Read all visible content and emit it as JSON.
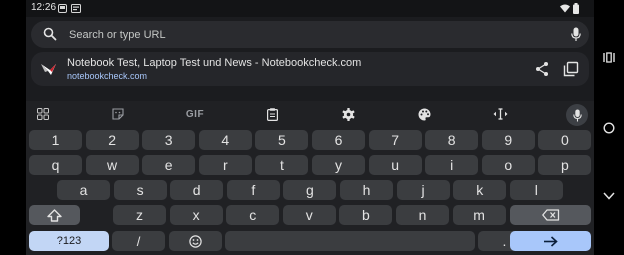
{
  "status_bar": {
    "time": "12:26"
  },
  "search": {
    "placeholder": "Search or type URL",
    "value": ""
  },
  "suggestion": {
    "title": "Notebook Test, Laptop Test und News - Notebookcheck.com",
    "url": "notebookcheck.com"
  },
  "keyboard": {
    "toolbar": {
      "gif_label": "GIF"
    },
    "number_row": [
      "1",
      "2",
      "3",
      "4",
      "5",
      "6",
      "7",
      "8",
      "9",
      "0"
    ],
    "row1": [
      "q",
      "w",
      "e",
      "r",
      "t",
      "y",
      "u",
      "i",
      "o",
      "p"
    ],
    "row2": [
      "a",
      "s",
      "d",
      "f",
      "g",
      "h",
      "j",
      "k",
      "l"
    ],
    "row3": [
      "z",
      "x",
      "c",
      "v",
      "b",
      "n",
      "m"
    ],
    "bottom": {
      "symbols": "?123",
      "slash": "/",
      "period": "."
    }
  },
  "colors": {
    "accent": "#a8c7fa",
    "key": "#3b3d40",
    "keyboard_bg": "#202124",
    "surface": "#1b1c1f"
  }
}
